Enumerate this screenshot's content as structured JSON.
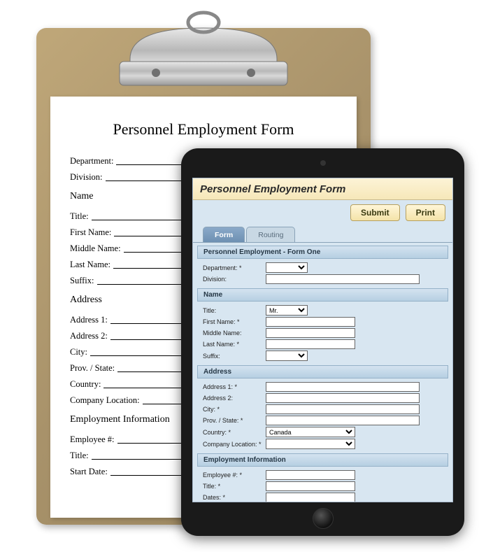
{
  "paper": {
    "title": "Personnel Employment Form",
    "top_fields": [
      "Department:",
      "Division:"
    ],
    "sections": [
      {
        "heading": "Name",
        "fields": [
          "Title:",
          "First Name:",
          "Middle Name:",
          "Last Name:",
          "Suffix:"
        ]
      },
      {
        "heading": "Address",
        "fields": [
          "Address 1:",
          "Address 2:",
          "City:",
          "Prov. / State:",
          "Country:",
          "Company Location:"
        ]
      },
      {
        "heading": "Employment Information",
        "fields": [
          "Employee #:",
          "Title:",
          "Start Date:"
        ]
      }
    ]
  },
  "tablet": {
    "title": "Personnel Employment Form",
    "buttons": {
      "submit": "Submit",
      "print": "Print"
    },
    "tabs": {
      "form": "Form",
      "routing": "Routing"
    },
    "sections": [
      {
        "heading": "Personnel Employment - Form One",
        "fields": [
          {
            "label": "Department: *",
            "type": "select",
            "value": "",
            "width": "w60"
          },
          {
            "label": "Division:",
            "type": "text",
            "width": "w210"
          }
        ]
      },
      {
        "heading": "Name",
        "fields": [
          {
            "label": "Title:",
            "type": "select",
            "value": "Mr.",
            "width": "w60"
          },
          {
            "label": "First Name: *",
            "type": "text",
            "width": "w120"
          },
          {
            "label": "Middle Name:",
            "type": "text",
            "width": "w120"
          },
          {
            "label": "Last Name: *",
            "type": "text",
            "width": "w120"
          },
          {
            "label": "Suffix:",
            "type": "select",
            "value": "",
            "width": "w60"
          }
        ]
      },
      {
        "heading": "Address",
        "fields": [
          {
            "label": "Address 1: *",
            "type": "text",
            "width": "w210"
          },
          {
            "label": "Address 2:",
            "type": "text",
            "width": "w210"
          },
          {
            "label": "City: *",
            "type": "text",
            "width": "w210"
          },
          {
            "label": "Prov. / State: *",
            "type": "text",
            "width": "w210"
          },
          {
            "label": "Country: *",
            "type": "select",
            "value": "Canada",
            "width": "w120"
          },
          {
            "label": "Company Location: *",
            "type": "select",
            "value": "",
            "width": "w120"
          }
        ]
      },
      {
        "heading": "Employment Information",
        "fields": [
          {
            "label": "Employee #: *",
            "type": "text",
            "width": "w120"
          },
          {
            "label": "Title: *",
            "type": "text",
            "width": "w120"
          },
          {
            "label": "Dates: *",
            "type": "text",
            "width": "w120"
          }
        ]
      }
    ]
  }
}
